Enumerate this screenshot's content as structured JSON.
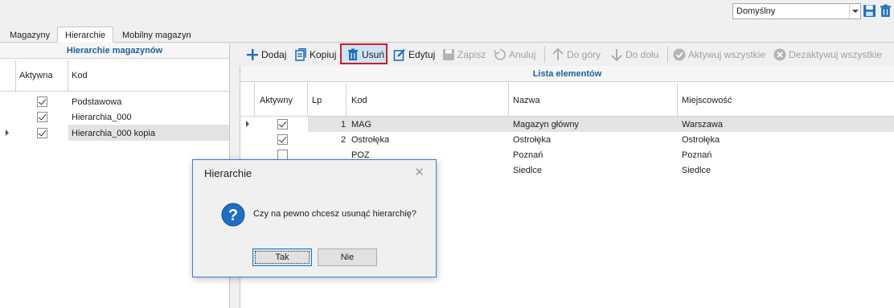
{
  "topbar": {
    "combo_value": "Domyślny",
    "icons": [
      "save-icon",
      "delete-icon"
    ]
  },
  "tabs": [
    {
      "label": "Magazyny"
    },
    {
      "label": "Hierarchie"
    },
    {
      "label": "Mobilny magazyn"
    }
  ],
  "left_panel": {
    "title": "Hierarchie magazynów",
    "columns": [
      "Aktywna",
      "Kod"
    ],
    "rows": [
      {
        "active": true,
        "code": "Podstawowa"
      },
      {
        "active": true,
        "code": "Hierarchia_000"
      },
      {
        "active": true,
        "code": "Hierarchia_000 kopia"
      }
    ]
  },
  "toolbar": {
    "add": "Dodaj",
    "copy": "Kopiuj",
    "delete": "Usuń",
    "edit": "Edytuj",
    "save": "Zapisz",
    "cancel": "Anuluj",
    "up": "Do góry",
    "down": "Do dołu",
    "activate_all": "Aktywuj wszystkie",
    "deactivate_all": "Dezaktywuj wszystkie"
  },
  "right_panel": {
    "title": "Lista elementów",
    "columns": [
      "Aktywny",
      "Lp",
      "Kod",
      "Nazwa",
      "Miejscowość"
    ],
    "rows": [
      {
        "active": true,
        "lp": "1",
        "code": "MAG",
        "name": "Magazyn główny",
        "city": "Warszawa"
      },
      {
        "active": true,
        "lp": "2",
        "code": "Ostrołęka",
        "name": "Ostrołęka",
        "city": "Ostrołęka"
      },
      {
        "active": false,
        "lp": "",
        "code": "POZ",
        "name": "Poznań",
        "city": "Poznań"
      },
      {
        "active": false,
        "lp": "",
        "code": "",
        "name": "Siedlce",
        "city": "Siedlce"
      }
    ]
  },
  "dialog": {
    "title": "Hierarchie",
    "message": "Czy na pewno chcesz usunąć hierarchię?",
    "yes": "Tak",
    "no": "Nie",
    "icon": "question-icon"
  },
  "colors": {
    "accent_title": "#1f5fa0",
    "highlight_border": "#d02020",
    "dialog_border": "#3b7dd8",
    "question_icon": "#1d6fc4"
  }
}
